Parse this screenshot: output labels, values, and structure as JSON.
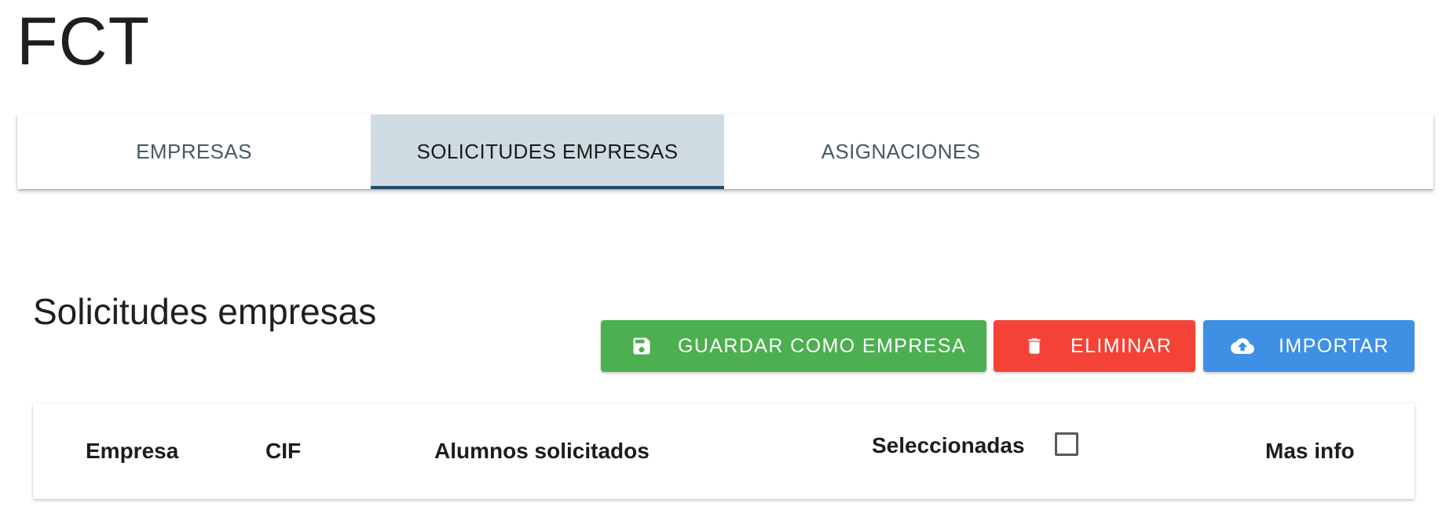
{
  "app": {
    "title": "FCT"
  },
  "tabs": [
    {
      "label": "EMPRESAS",
      "active": false
    },
    {
      "label": "SOLICITUDES EMPRESAS",
      "active": true
    },
    {
      "label": "ASIGNACIONES",
      "active": false
    }
  ],
  "section": {
    "title": "Solicitudes empresas"
  },
  "actions": {
    "save": {
      "label": "GUARDAR COMO EMPRESA",
      "icon": "save-icon",
      "color": "#4caf50"
    },
    "delete": {
      "label": "ELIMINAR",
      "icon": "trash-icon",
      "color": "#f44336"
    },
    "import": {
      "label": "IMPORTAR",
      "icon": "cloud-upload-icon",
      "color": "#3f8fe4"
    }
  },
  "table": {
    "columns": {
      "empresa": "Empresa",
      "cif": "CIF",
      "alumnos": "Alumnos solicitados",
      "seleccionadas": "Seleccionadas",
      "mas_info": "Mas info"
    },
    "select_all_checked": false,
    "rows": []
  },
  "colors": {
    "active_tab_bg": "#cfdbe2",
    "active_tab_indicator": "#1d4f6b",
    "tab_text": "#455a64"
  }
}
